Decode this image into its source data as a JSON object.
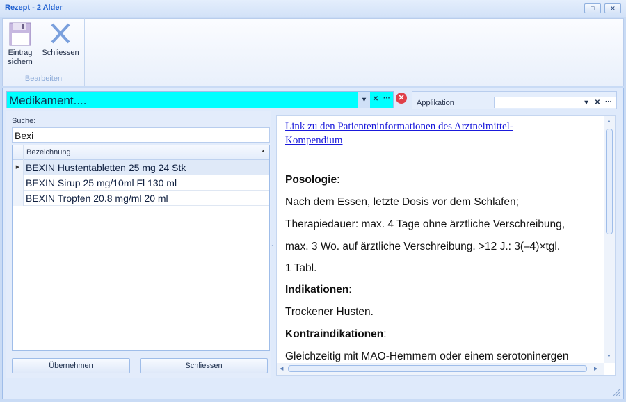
{
  "window": {
    "title": "Rezept - 2 Alder",
    "restore_icon": "□",
    "close_icon": "✕"
  },
  "ribbon": {
    "save_label_1": "Eintrag",
    "save_label_2": "sichern",
    "close_label": "Schliessen",
    "group_label": "Bearbeiten"
  },
  "medikament": {
    "value": "Medikament....",
    "dropdown": "▾",
    "clear": "✕",
    "more": "···"
  },
  "applikation": {
    "label": "Applikation",
    "value": "",
    "dropdown": "▾",
    "clear": "✕",
    "more": "···"
  },
  "search": {
    "label": "Suche:",
    "value": "Bexi"
  },
  "grid": {
    "column": "Bezeichnung",
    "sort_icon": "▲",
    "row_indicator": "▶",
    "rows": [
      "BEXIN Hustentabletten 25 mg 24 Stk",
      "BEXIN Sirup 25 mg/10ml Fl 130 ml",
      "BEXIN Tropfen 20.8 mg/ml 20 ml"
    ]
  },
  "buttons": {
    "accept": "Übernehmen",
    "close": "Schliessen"
  },
  "doc": {
    "link": "Link zu den Patienteninformationen des Arztneimittel-Kompendium",
    "posologie": "Posologie",
    "colon": ":",
    "line1": "Nach dem Essen, letzte Dosis vor dem Schlafen;",
    "line2": "Therapiedauer: max. 4 Tage ohne ärztliche Verschreibung,",
    "line3": "max. 3 Wo. auf ärztliche Verschreibung. >12 J.: 3(–4)×tgl.",
    "line4": "1 Tabl.",
    "indikationen": "Indikationen",
    "line5": "Trockener Husten.",
    "kontra": "Kontraindikationen",
    "line6": "Gleichzeitig mit MAO-Hemmern oder einem serotoninergen"
  }
}
